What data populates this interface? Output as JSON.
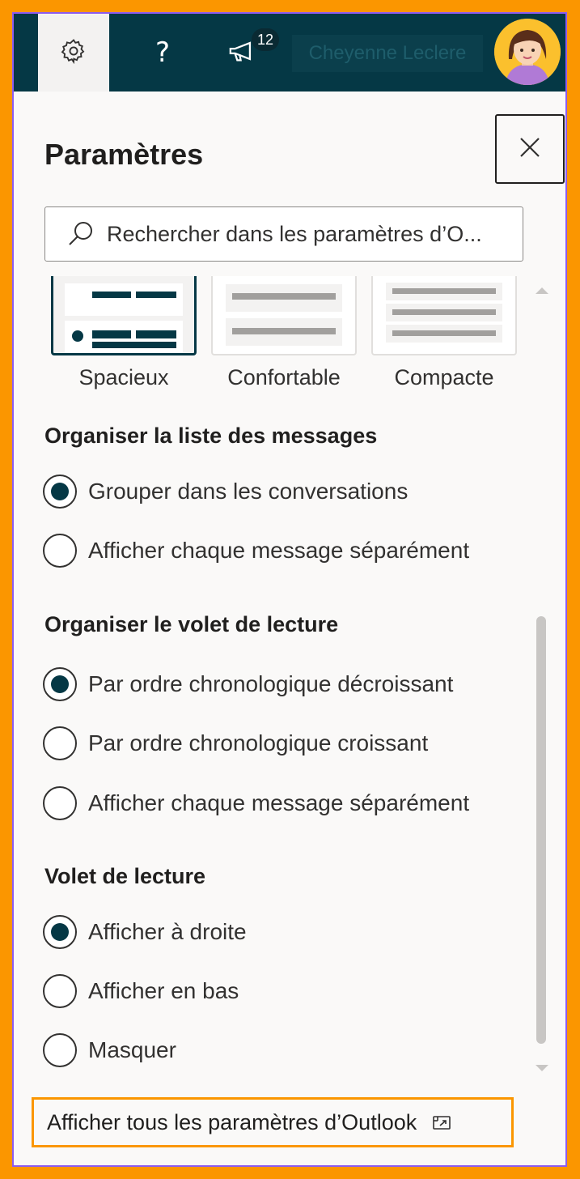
{
  "topbar": {
    "settings_icon": "gear-icon",
    "help_label": "?",
    "notification_icon": "megaphone-icon",
    "notification_count": "12",
    "user_name": "Cheyenne Leclere",
    "colors": {
      "bar": "#053845",
      "active_tab": "#f3f2f1"
    }
  },
  "panel": {
    "title": "Paramètres",
    "close_icon": "close-icon",
    "search": {
      "placeholder": "Rechercher dans les paramètres d’O..."
    },
    "density": {
      "options": [
        "Spacieux",
        "Confortable",
        "Compacte"
      ],
      "selected": "Spacieux"
    },
    "sections": [
      {
        "title": "Organiser la liste des messages",
        "options": [
          {
            "label": "Grouper dans les conversations",
            "checked": true
          },
          {
            "label": "Afficher chaque message séparément",
            "checked": false
          }
        ]
      },
      {
        "title": "Organiser le volet de lecture",
        "options": [
          {
            "label": "Par ordre chronologique décroissant",
            "checked": true
          },
          {
            "label": "Par ordre chronologique croissant",
            "checked": false
          },
          {
            "label": "Afficher chaque message séparément",
            "checked": false
          }
        ]
      },
      {
        "title": "Volet de lecture",
        "options": [
          {
            "label": "Afficher à droite",
            "checked": true
          },
          {
            "label": "Afficher en bas",
            "checked": false
          },
          {
            "label": "Masquer",
            "checked": false
          }
        ]
      }
    ],
    "footer": {
      "link_label": "Afficher tous les paramètres d’Outlook",
      "icon": "external-link-icon"
    }
  },
  "colors": {
    "accent": "#053845",
    "highlight_border": "#fb9600",
    "frame_border": "#8c5cf0"
  }
}
